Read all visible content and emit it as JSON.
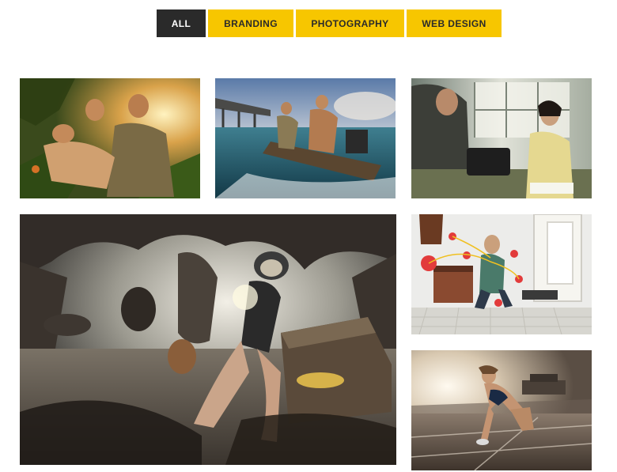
{
  "filters": {
    "all": "ALL",
    "branding": "BRANDING",
    "photography": "PHOTOGRAPHY",
    "web_design": "WEB DESIGN",
    "active": "ALL"
  },
  "colors": {
    "active_bg": "#2a2a2a",
    "inactive_bg": "#f7c600",
    "page_bg": "#ffffff"
  },
  "portfolio": {
    "items": [
      {
        "subject": "jungle-scene-photo"
      },
      {
        "subject": "boat-river-photo"
      },
      {
        "subject": "typewriter-office-photo"
      },
      {
        "subject": "cave-treasure-diver-photo"
      },
      {
        "subject": "room-fix-it-photo"
      },
      {
        "subject": "sprinter-track-photo"
      }
    ]
  }
}
